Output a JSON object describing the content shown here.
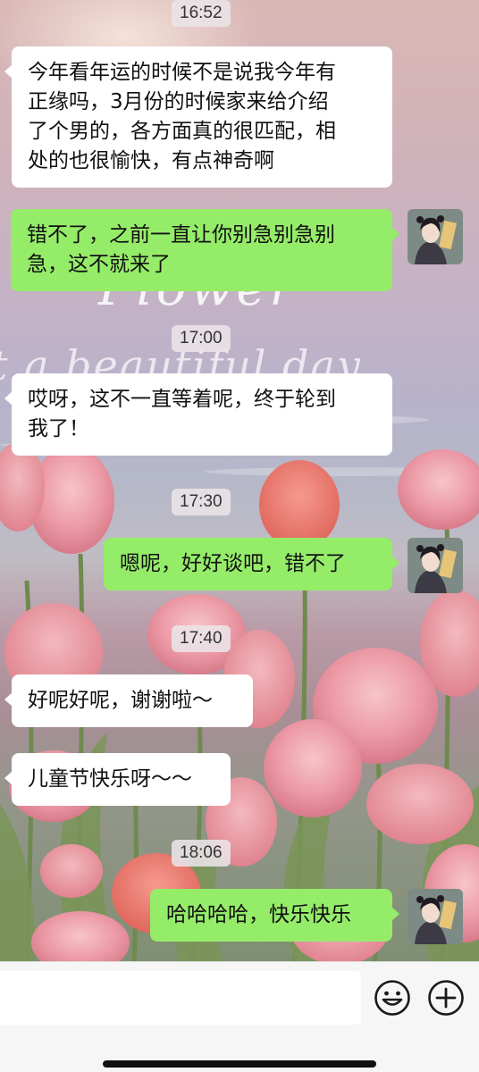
{
  "chat": {
    "wallpaper_script_1": "Flower",
    "wallpaper_script_2": "t a beautiful day",
    "messages": [
      {
        "type": "time",
        "text": "16:52"
      },
      {
        "type": "received",
        "text": "今年看年运的时候不是说我今年有正缘吗，3月份的时候家来给介绍了个男的，各方面真的很匹配，相处的也很愉快，有点神奇啊"
      },
      {
        "type": "sent",
        "text": "错不了，之前一直让你别急别急别急，这不就来了"
      },
      {
        "type": "time",
        "text": "17:00"
      },
      {
        "type": "received",
        "text": "哎呀，这不一直等着呢，终于轮到我了！"
      },
      {
        "type": "time",
        "text": "17:30"
      },
      {
        "type": "sent",
        "text": "嗯呢，好好谈吧，错不了"
      },
      {
        "type": "time",
        "text": "17:40"
      },
      {
        "type": "received",
        "text": "好呢好呢，谢谢啦～"
      },
      {
        "type": "received",
        "text": "儿童节快乐呀～～"
      },
      {
        "type": "time",
        "text": "18:06"
      },
      {
        "type": "sent",
        "text": "哈哈哈哈，快乐快乐"
      }
    ]
  },
  "bubble_lines": {
    "m1": [
      "今年看年运的时候不是说我今年有",
      "正缘吗，3月份的时候家来给介绍",
      "了个男的，各方面真的很匹配，相",
      "处的也很愉快，有点神奇啊"
    ],
    "m2": [
      "错不了，之前一直让你别急别急别",
      "急，这不就来了"
    ],
    "m3": [
      "哎呀，这不一直等着呢，终于轮到",
      "我了！"
    ]
  },
  "input": {
    "value": "",
    "placeholder": ""
  },
  "icons": {
    "emoji": "emoji-smile-icon",
    "plus": "plus-circle-icon"
  },
  "colors": {
    "sent_bubble": "#95ec69",
    "received_bubble": "#ffffff",
    "time_pill": "#ebe4e8"
  }
}
